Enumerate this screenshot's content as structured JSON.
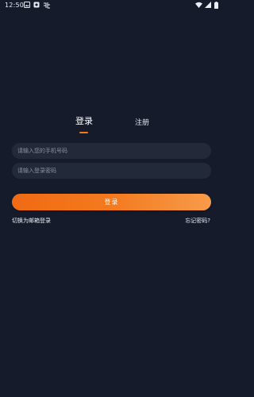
{
  "status_bar": {
    "time": "12:50",
    "left_icons": [
      "image-icon",
      "notification-icon",
      "app-badge-icon"
    ],
    "right_icons": [
      "wifi-icon",
      "signal-icon",
      "battery-icon"
    ]
  },
  "tabs": {
    "login_label": "登录",
    "register_label": "注册",
    "active": "login"
  },
  "form": {
    "phone_placeholder": "请输入您的手机号码",
    "phone_value": "",
    "password_placeholder": "请输入登录密码",
    "password_value": ""
  },
  "login_button_label": "登录",
  "links": {
    "switch_email": "切换为邮箱登录",
    "forgot_password": "忘记密码?"
  },
  "colors": {
    "background": "#151b2b",
    "input_background": "#222a39",
    "accent": "#f07a1c"
  }
}
